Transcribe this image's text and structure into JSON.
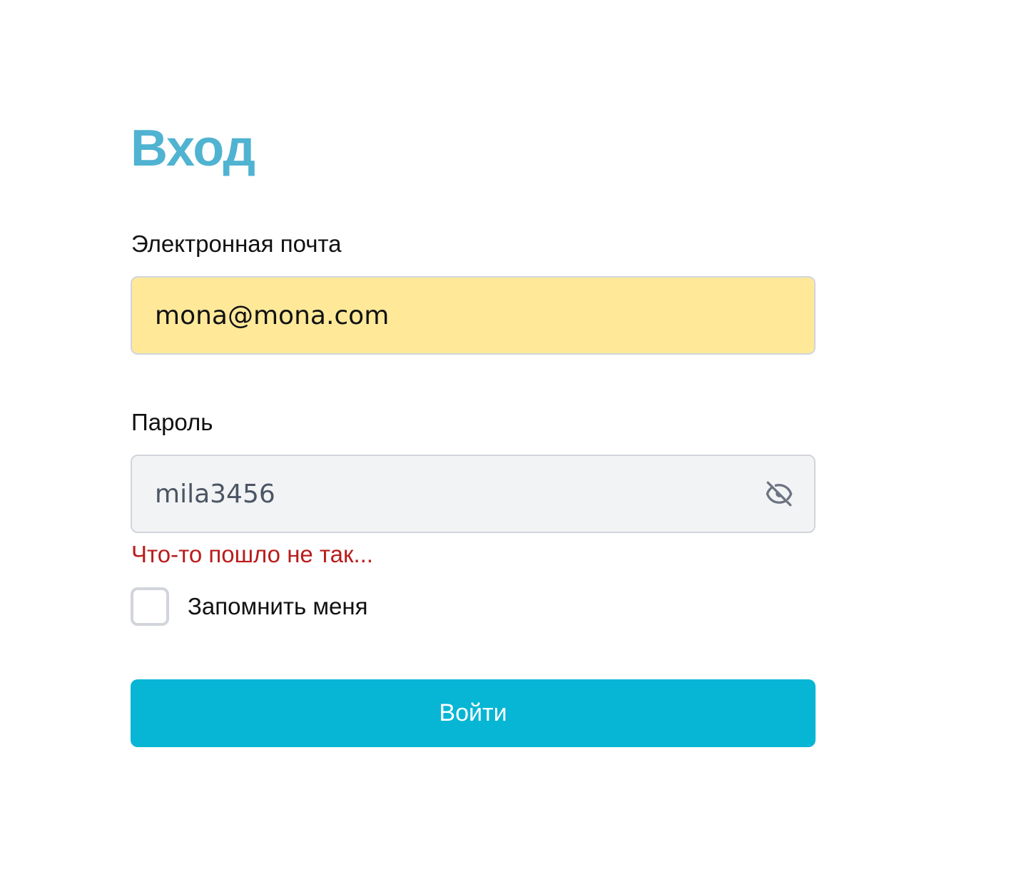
{
  "colors": {
    "title": "#4fb3d1",
    "email_field_bg": "#ffe999",
    "password_field_bg": "#f2f3f5",
    "field_border": "#d1d5db",
    "error": "#b91c1c",
    "button_bg": "#06b6d4",
    "button_text": "#ffffff",
    "icon": "#6b7280"
  },
  "form": {
    "title": "Вход",
    "email": {
      "label": "Электронная почта",
      "value": "mona@mona.com"
    },
    "password": {
      "label": "Пароль",
      "value": "mila3456",
      "toggle_icon": "eye-off-icon"
    },
    "error": "Что-то пошло не так...",
    "remember": {
      "label": "Запомнить меня",
      "checked": false
    },
    "submit_label": "Войти"
  }
}
